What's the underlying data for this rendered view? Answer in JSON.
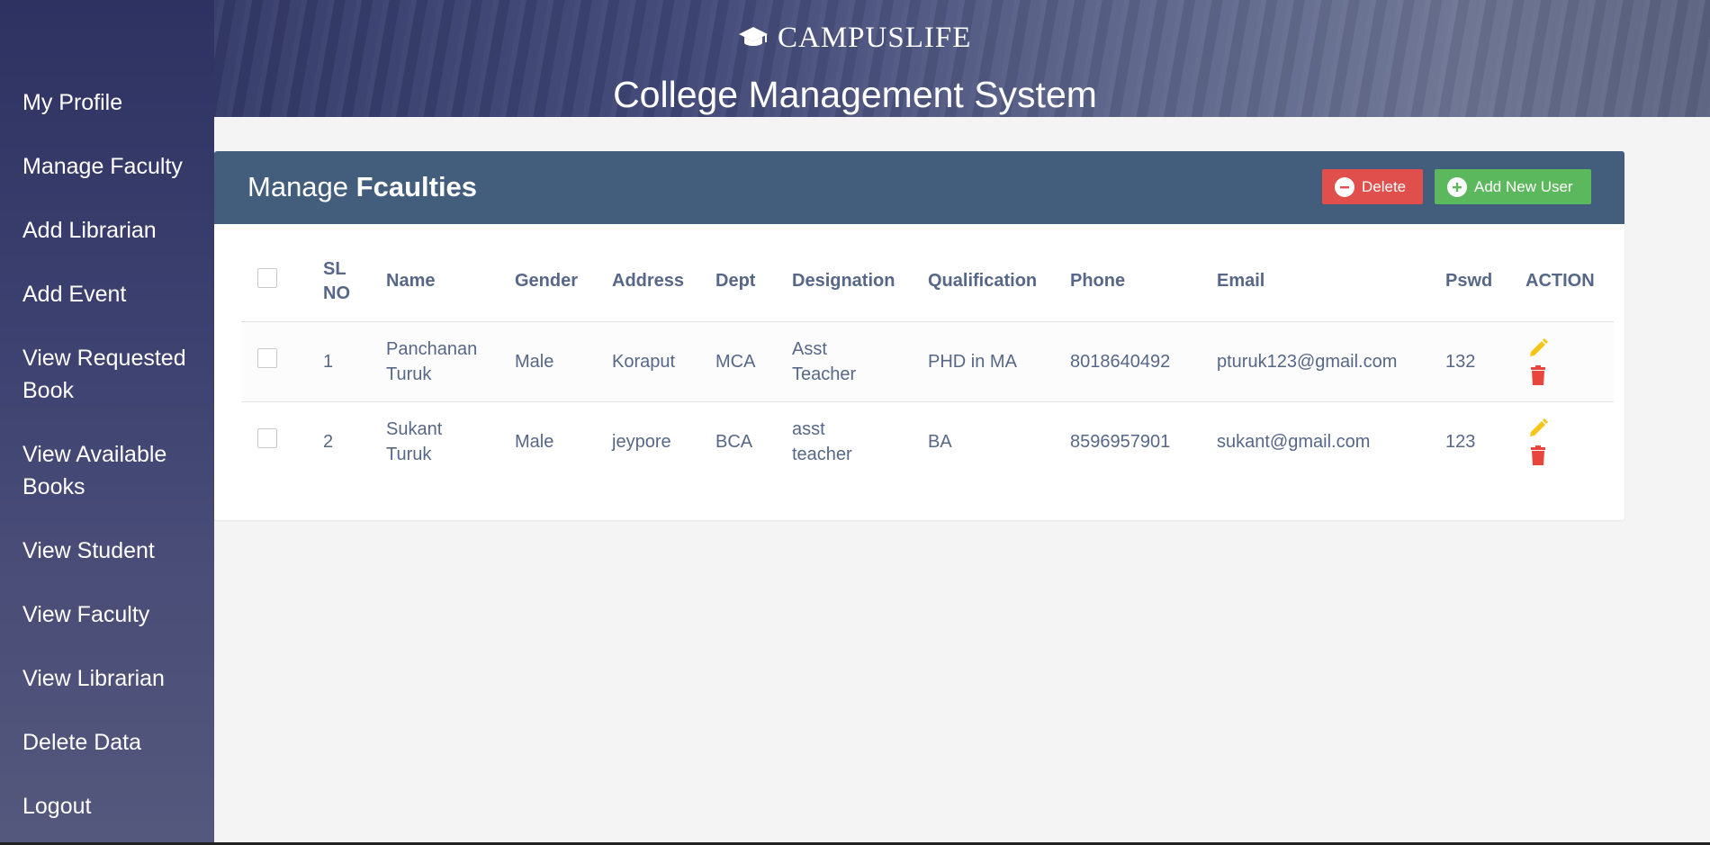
{
  "brand": {
    "name": "CAMPUSLIFE",
    "icon": "graduation-cap-icon"
  },
  "app_title": "College Management System",
  "sidebar": {
    "items": [
      {
        "label": "My Profile"
      },
      {
        "label": "Manage Faculty"
      },
      {
        "label": "Add Librarian"
      },
      {
        "label": "Add Event"
      },
      {
        "label": "View Requested Book"
      },
      {
        "label": "View Available Books"
      },
      {
        "label": "View Student"
      },
      {
        "label": "View Faculty"
      },
      {
        "label": "View Librarian"
      },
      {
        "label": "Delete Data"
      },
      {
        "label": "Logout"
      }
    ]
  },
  "panel": {
    "title_prefix": "Manage",
    "title_bold": "Fcaulties",
    "delete_label": "Delete",
    "add_label": "Add New User"
  },
  "table": {
    "headers": {
      "sl_no": "SL NO",
      "name": "Name",
      "gender": "Gender",
      "address": "Address",
      "dept": "Dept",
      "designation": "Designation",
      "qualification": "Qualification",
      "phone": "Phone",
      "email": "Email",
      "pswd": "Pswd",
      "action": "ACTION"
    },
    "rows": [
      {
        "sl_no": "1",
        "name": "Panchanan Turuk",
        "gender": "Male",
        "address": "Koraput",
        "dept": "MCA",
        "designation": "Asst Teacher",
        "qualification": "PHD in MA",
        "phone": "8018640492",
        "email": "pturuk123@gmail.com",
        "pswd": "132"
      },
      {
        "sl_no": "2",
        "name": "Sukant Turuk",
        "gender": "Male",
        "address": "jeypore",
        "dept": "BCA",
        "designation": "asst teacher",
        "qualification": "BA",
        "phone": "8596957901",
        "email": "sukant@gmail.com",
        "pswd": "123"
      }
    ]
  },
  "colors": {
    "header_blue": "#435d7d",
    "delete_red": "#e04f4b",
    "add_green": "#5cb85c",
    "edit_yellow": "#f5c518",
    "trash_red": "#e8453c",
    "sidebar_navy": "#2e3261"
  }
}
